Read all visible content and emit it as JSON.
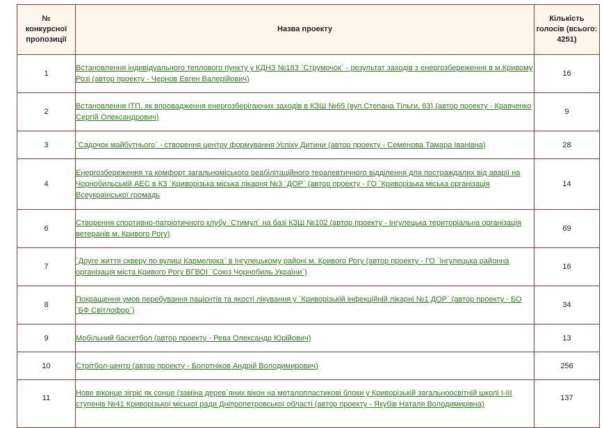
{
  "header": {
    "col_number": "№ конкурсної пропозиції",
    "col_name": "Назва проекту",
    "col_votes": "Кількість голосів (всього: 4251)"
  },
  "rows": [
    {
      "number": "1",
      "title": "Встановлення індивідуального теплового пункту у КДНЗ №183 `Струмочок` - результат заходів з енергозбереження в м.Кривому Розі (автор проекту - Чернов Евген Валерійович)",
      "votes": "16"
    },
    {
      "number": "2",
      "title": "Встановлення ІТП, як впровадження енергозберігаючих заходів в КЗШ №65 (вул.Степана Тільги, 63) (автор проекту - Кравченко Сергій Олександрович)",
      "votes": "9"
    },
    {
      "number": "3",
      "title": "`Садочок майбутнього` - створення центру формування Успіху Дитини (автор проекту - Семенова Тамара Іванівна)",
      "votes": "28"
    },
    {
      "number": "4",
      "title": "Енергозбереження та комфорт загальноміського реабілітаційного терапевтичного відділення для постраждалих від аварії на Чорнобильській АЕС в КЗ `Криворізька міська лікарня №3 `ДОР` (автор проекту - ГО `Криворізька міська організація Всеукраїнської громадь",
      "votes": "14"
    },
    {
      "number": "6",
      "title": "Створення спортивно-патріотичного клубу `Стимул` на базі КЗШ №102 (автор проекту - Інгулецька територіальна організація ветеранів м. Кривого Рогу)",
      "votes": "69"
    },
    {
      "number": "7",
      "title": "`Друге життя скверу по вулиці Кармелюка` в Інгулецькому районі м. Кривого Рогу (автор проекту - ГО `Інгулецька районна організація міста Кривого Рогу ВГВОІ `Союз Чорнобиль України`)",
      "votes": "16"
    },
    {
      "number": "8",
      "title": "Покращення умов перебування пацієнтів та якості лікування у `Криворізькій інфекційній лікарні №1 ДОР` (автор проекту - БО `БФ Світлофор`)",
      "votes": "34"
    },
    {
      "number": "9",
      "title": "Мобільний баскетбол (автор проекту - Рева Олександр Юрійович)",
      "votes": "13"
    },
    {
      "number": "10",
      "title": "Стрітбол-центр (автор проекту - Болотніков Андрій Володимирович)",
      "votes": "256"
    },
    {
      "number": "11",
      "title": "Нове віконце зігріє як сонце (заміна дерев`яних вікон на металопластикові блоки у Криворізькій загальноосвітній школі І-ІІІ ступенів №41 Криворізької міської ради Дніпропетровської області (автор проекту - Якубів Наталя Володимирівна)",
      "votes": "137"
    }
  ]
}
